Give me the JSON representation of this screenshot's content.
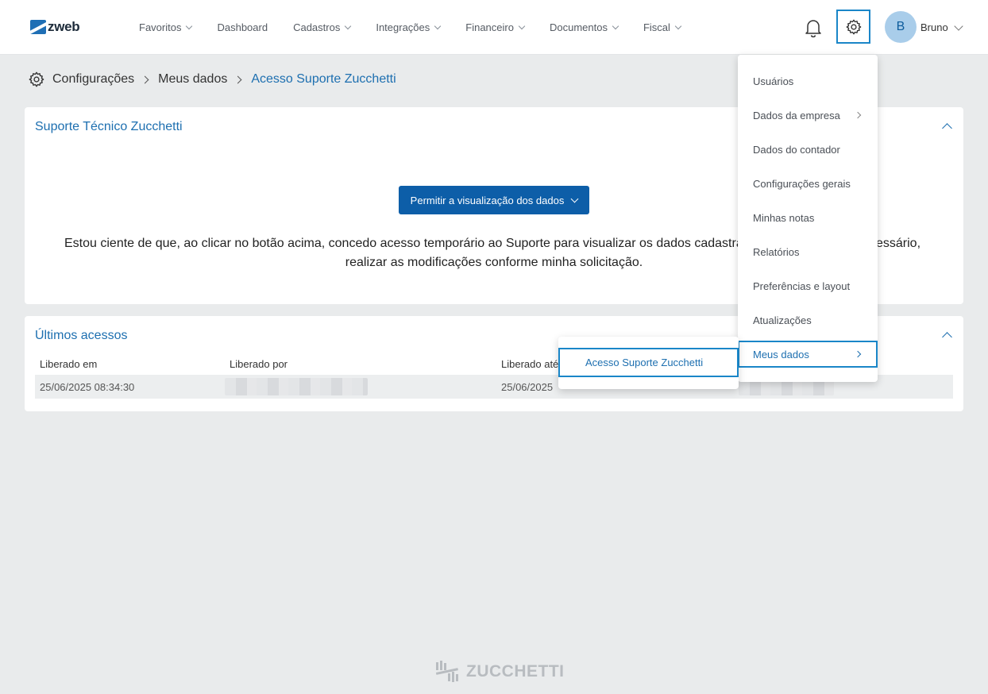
{
  "brand": {
    "logo_text": "zweb",
    "footer_text": "ZUCCHETTI"
  },
  "nav": {
    "items": [
      {
        "label": "Favoritos",
        "has_menu": true
      },
      {
        "label": "Dashboard",
        "has_menu": false
      },
      {
        "label": "Cadastros",
        "has_menu": true
      },
      {
        "label": "Integrações",
        "has_menu": true
      },
      {
        "label": "Financeiro",
        "has_menu": true
      },
      {
        "label": "Documentos",
        "has_menu": true
      },
      {
        "label": "Fiscal",
        "has_menu": true
      }
    ]
  },
  "user": {
    "initial": "B",
    "name": "Bruno"
  },
  "breadcrumb": {
    "root": "Configurações",
    "middle": "Meus dados",
    "current": "Acesso Suporte Zucchetti"
  },
  "support_card": {
    "title": "Suporte Técnico Zucchetti",
    "button_label": "Permitir a visualização dos dados",
    "consent_line1": "Estou ciente de que, ao clicar no botão acima, concedo acesso temporário ao Suporte para visualizar os dados cadastra",
    "consent_line1_end": "cessário,",
    "consent_line2": "realizar as modificações conforme minha solicitação."
  },
  "access_card": {
    "title": "Últimos acessos",
    "columns": [
      "Liberado em",
      "Liberado por",
      "Liberado até"
    ],
    "rows": [
      {
        "liberado_em": "25/06/2025 08:34:30",
        "liberado_ate": "25/06/2025"
      }
    ]
  },
  "settings_menu": {
    "items": [
      {
        "label": "Usuários",
        "has_submenu": false
      },
      {
        "label": "Dados da empresa",
        "has_submenu": true
      },
      {
        "label": "Dados do contador",
        "has_submenu": false
      },
      {
        "label": "Configurações gerais",
        "has_submenu": false
      },
      {
        "label": "Minhas notas",
        "has_submenu": false
      },
      {
        "label": "Relatórios",
        "has_submenu": false
      },
      {
        "label": "Preferências e layout",
        "has_submenu": false
      },
      {
        "label": "Atualizações",
        "has_submenu": false
      },
      {
        "label": "Meus dados",
        "has_submenu": true,
        "active": true
      }
    ],
    "submenu": {
      "label": "Acesso Suporte Zucchetti"
    }
  },
  "colors": {
    "accent": "#1d6fb0",
    "primary_button": "#0d5ea8",
    "highlight_border": "#1a86c8"
  }
}
